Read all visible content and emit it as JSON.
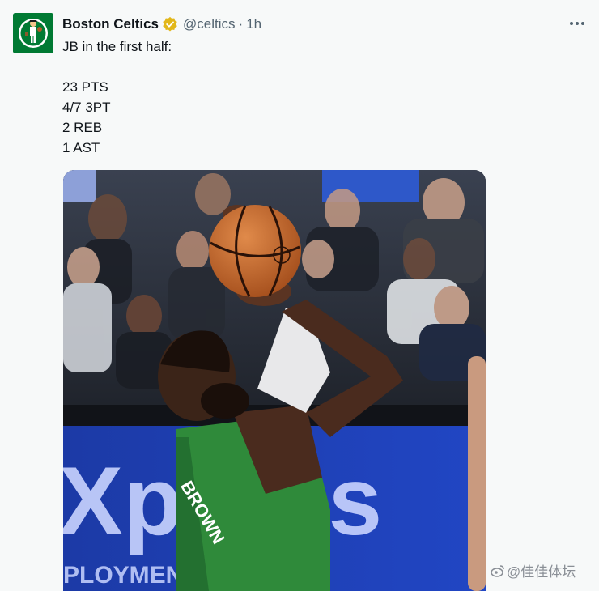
{
  "tweet": {
    "author": {
      "name": "Boston Celtics",
      "handle": "@celtics",
      "timestamp": "1h",
      "verified_color": "#e2b719"
    },
    "text_lines": [
      "JB in the first half:",
      "",
      "23 PTS",
      "4/7 3PT",
      "2 REB",
      "1 AST"
    ],
    "media": {
      "jersey_text": "BROWN",
      "banner_text": "Xpress",
      "banner_subtext": "PLOYMENT PR   NALS"
    }
  },
  "watermark": {
    "text": "@佳佳体坛"
  },
  "colors": {
    "accent_green": "#007a33",
    "text_primary": "#0f1419",
    "text_secondary": "#536471"
  },
  "icons": [
    "celtics-logo-icon",
    "verified-badge-icon",
    "more-options-icon",
    "weibo-icon"
  ]
}
